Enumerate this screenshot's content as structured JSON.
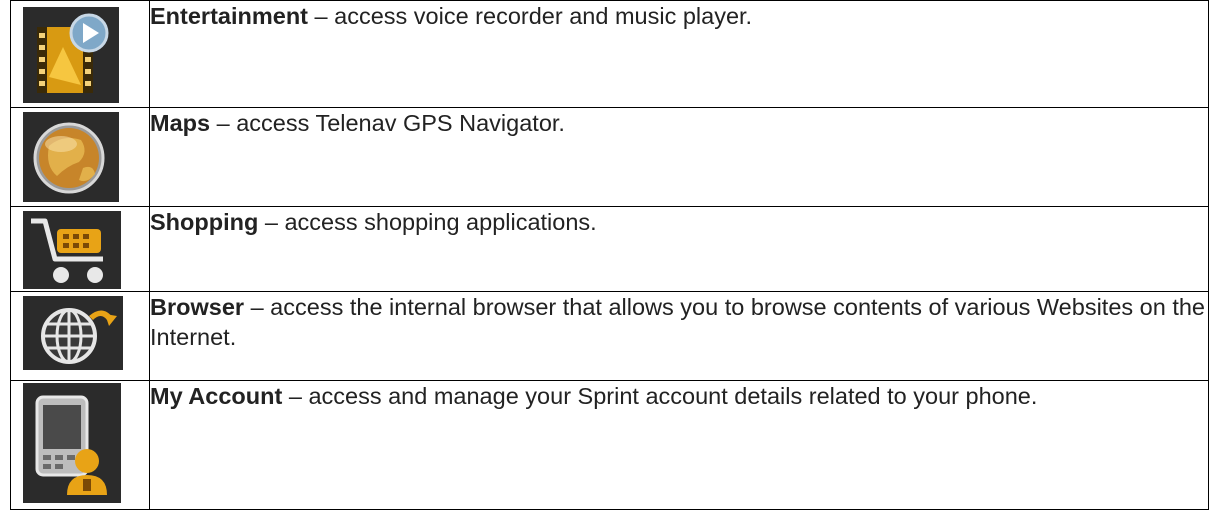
{
  "rows": [
    {
      "icon": "entertainment-film-play-icon",
      "title": "Entertainment",
      "description": " – access voice recorder and music player."
    },
    {
      "icon": "maps-globe-icon",
      "title": "Maps",
      "description": " – access Telenav GPS Navigator."
    },
    {
      "icon": "shopping-cart-icon",
      "title": "Shopping",
      "description": " – access shopping applications."
    },
    {
      "icon": "browser-globe-icon",
      "title": "Browser",
      "description": " – access the internal browser that allows you to browse contents of various Websites on the Internet."
    },
    {
      "icon": "my-account-phone-user-icon",
      "title": "My Account",
      "description": " – access and manage your Sprint account details related to your phone."
    }
  ],
  "colors": {
    "icon_background": "#2a2a2a",
    "accent_gold": "#e8a316",
    "text": "#222222"
  }
}
